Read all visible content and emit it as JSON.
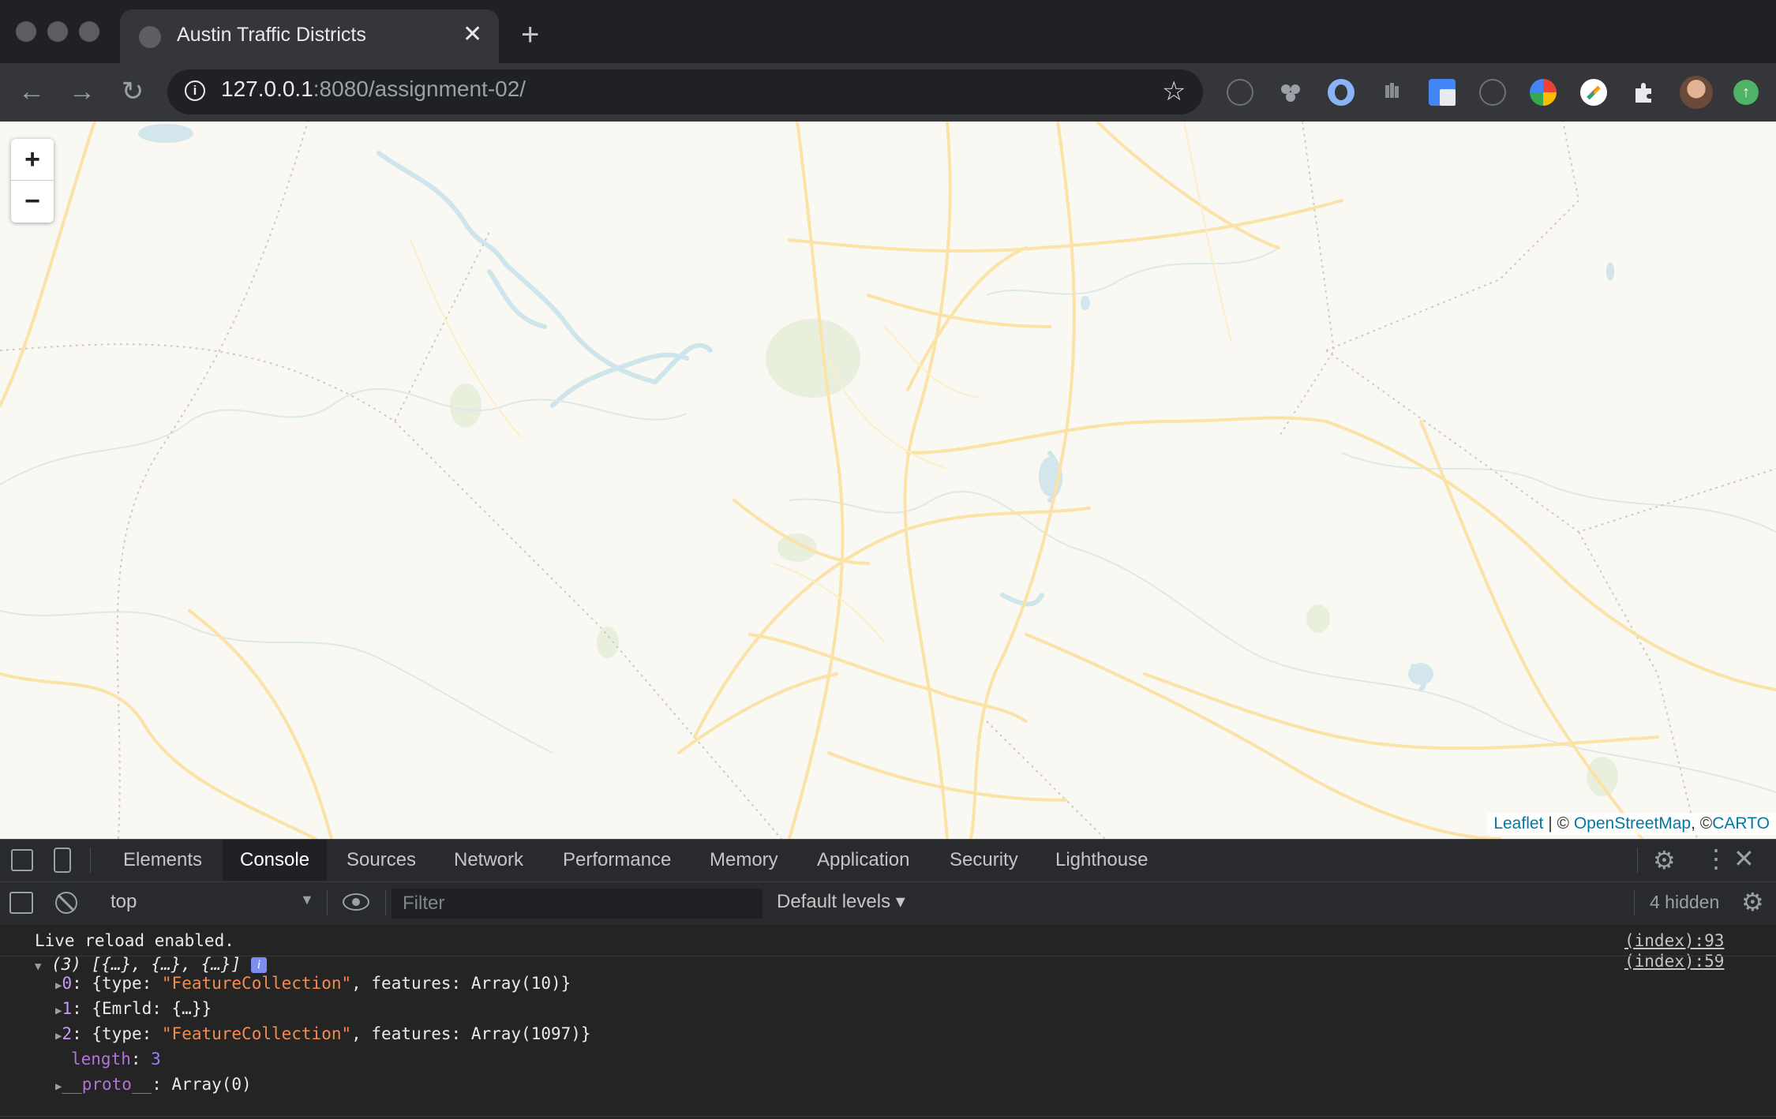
{
  "browser": {
    "tab_title": "Austin Traffic Districts",
    "tab_close": "✕",
    "new_tab": "+",
    "nav": {
      "back": "←",
      "forward": "→",
      "reload": "↻"
    },
    "url_host": "127.0.0.1",
    "url_rest": ":8080/assignment-02/",
    "bookmark_icon": "☆",
    "extension_icons": [
      "sync-icon",
      "puzzle-piece-icon",
      "circle-logo-icon",
      "hand-icon",
      "translate-icon",
      "info-icon",
      "color-wheel-icon",
      "color-picker-icon",
      "extensions-icon"
    ],
    "update_icon": "↑"
  },
  "map": {
    "zoom_in": "+",
    "zoom_out": "−",
    "attribution": {
      "leaflet": "Leaflet",
      "sep": " | © ",
      "osm": "OpenStreetMap",
      "sep2": ", ©",
      "carto": "CARTO"
    },
    "colors": {
      "background": "#faf8f3",
      "roads": "#fbe3a8",
      "water": "#cfe5ec",
      "parks": "#e8efdc",
      "boundaries": "#c9c6c0"
    }
  },
  "devtools": {
    "tabs": [
      "Elements",
      "Console",
      "Sources",
      "Network",
      "Performance",
      "Memory",
      "Application",
      "Security",
      "Lighthouse"
    ],
    "active_tab": "Console",
    "context": "top",
    "filter_placeholder": "Filter",
    "levels": "Default levels ▾",
    "hidden": "4 hidden",
    "console": {
      "live_reload": "Live reload enabled.",
      "live_reload_src": "(index):93",
      "array_summary": "(3) [{…}, {…}, {…}]",
      "array_src": "(index):59",
      "items": [
        {
          "index": "0",
          "prefix": "{type: ",
          "type": "\"FeatureCollection\"",
          "mid": ", features: ",
          "value": "Array(10)}"
        },
        {
          "index": "1",
          "text": "{Emrld: {…}}"
        },
        {
          "index": "2",
          "prefix": "{type: ",
          "type": "\"FeatureCollection\"",
          "mid": ", features: ",
          "value": "Array(1097)}"
        }
      ],
      "length_key": "length",
      "length_value": "3",
      "proto_key": "__proto__",
      "proto_value": "Array(0)"
    }
  }
}
